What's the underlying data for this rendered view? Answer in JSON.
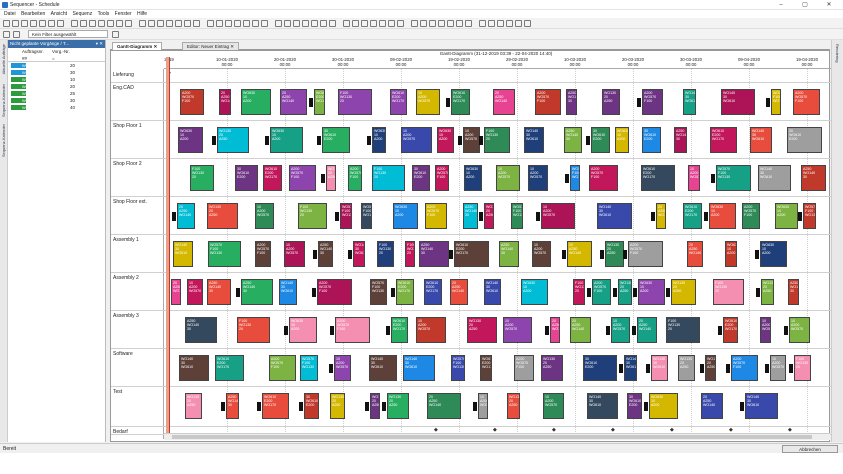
{
  "window": {
    "title": "Sequencer - Schedule",
    "min": "–",
    "max": "▢",
    "close": "✕"
  },
  "menu": [
    "Datei",
    "Bearbeiten",
    "Ansicht",
    "Sequenz",
    "Tools",
    "Fenster",
    "Hilfe"
  ],
  "filter": {
    "label": "Kein Filter ausgewählt"
  },
  "left_strip": {
    "tabs": [
      "Aktuelle Aufträge",
      "Sequenz-Kalender",
      "Sequenz-Kalender"
    ]
  },
  "right_strip": {
    "label": "Rendering"
  },
  "left_panel": {
    "header": "Nicht geplante Vorgänge / T...",
    "pin": "▾ ✕",
    "col_order": "Auftragsnr.",
    "col_qty": "Vorg.-Nr.",
    "filter_op": "##",
    "filter_op2": "=",
    "rows": [
      {
        "code": "WO670",
        "qty": "20",
        "color": "#2196d6"
      },
      {
        "code": "WO670",
        "qty": "30",
        "color": "#2196d6"
      },
      {
        "code": "WO680",
        "qty": "10",
        "color": "#2e9a3e"
      },
      {
        "code": "WO680",
        "qty": "20",
        "color": "#2e9a3e"
      },
      {
        "code": "WO690",
        "qty": "25",
        "color": "#2e9a3e"
      },
      {
        "code": "WO690",
        "qty": "30",
        "color": "#2e9a3e"
      },
      {
        "code": "WO690",
        "qty": "40",
        "color": "#2e9a3e"
      }
    ]
  },
  "tabs": [
    {
      "label": "Gantt-Diagramm",
      "active": true
    },
    {
      "label": "Editor: Neuer Eintrag",
      "active": false
    }
  ],
  "gantt": {
    "title": "Gantt-Diagramm    (31-12-2019 03:39 - 22-04-2020 14:40)",
    "date_axis": [
      {
        "label": "2019",
        "time": ""
      },
      {
        "label": "10-01-2020",
        "time": "00:00"
      },
      {
        "label": "20-01-2020",
        "time": "00:00"
      },
      {
        "label": "30-01-2020",
        "time": "00:00"
      },
      {
        "label": "09-02-2020",
        "time": "00:00"
      },
      {
        "label": "19-02-2020",
        "time": "00:00"
      },
      {
        "label": "29-02-2020",
        "time": "00:00"
      },
      {
        "label": "10-03-2020",
        "time": "00:00"
      },
      {
        "label": "20-03-2020",
        "time": "00:00"
      },
      {
        "label": "30-03-2020",
        "time": "00:00"
      },
      {
        "label": "09-04-2020",
        "time": "00:00"
      },
      {
        "label": "19-04-2020",
        "time": "00:00"
      }
    ],
    "rows": [
      "Lieferung",
      "Eng.CAD",
      "Shop Floor 1",
      "Shop Floor 2",
      "Shop Floor ext.",
      "Assembly 1",
      "Assembly 2",
      "Assembly 3",
      "Software",
      "Test",
      "Bedarf"
    ],
    "bar_texts": [
      "WO630",
      "10",
      "A200",
      "WO570",
      "F100",
      "WO130",
      "20",
      "A250",
      "WO140",
      "30",
      "WO610",
      "E200",
      "WO170"
    ]
  },
  "status": {
    "left": "Bereit",
    "cancel": "Abbrechen"
  }
}
